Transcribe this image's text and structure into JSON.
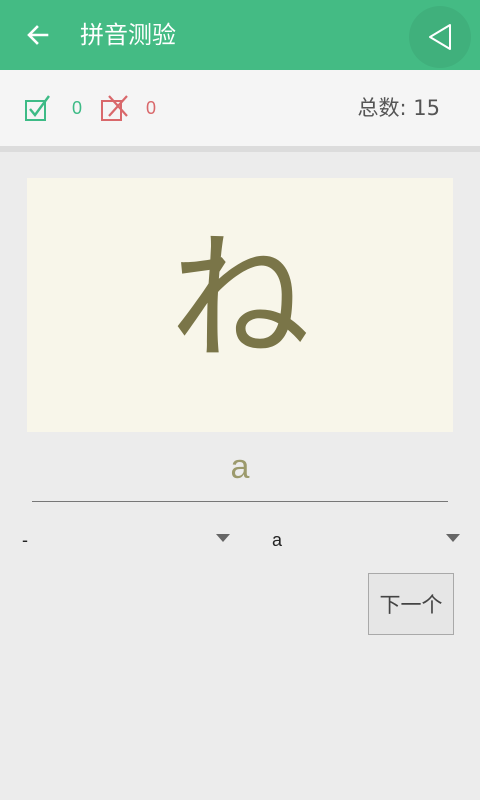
{
  "appbar": {
    "title": "拼音测验",
    "back_icon": "arrow-left-icon",
    "play_icon": "play-triangle-icon",
    "background": "#44bb84"
  },
  "score": {
    "correct_icon": "check-box-icon",
    "correct_count": "0",
    "correct_color": "#3dbb86",
    "wrong_icon": "cross-box-icon",
    "wrong_count": "0",
    "wrong_color": "#d9686b",
    "total_label": "总数: 15"
  },
  "card": {
    "kana": "ね",
    "text_color": "#7a7548",
    "background": "#f8f6ea"
  },
  "answer": {
    "text": "a"
  },
  "spinners": {
    "first_value": "-",
    "second_value": "a"
  },
  "next_button": {
    "label": "下一个"
  }
}
